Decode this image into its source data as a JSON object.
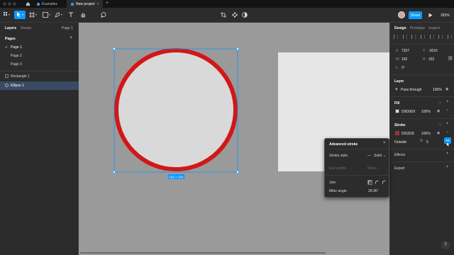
{
  "tabs": [
    {
      "label": "Examples"
    },
    {
      "label": "New project",
      "close": "×"
    }
  ],
  "toolbar": {
    "share_label": "Share",
    "zoom_label": "283%"
  },
  "left_panel": {
    "tabs": [
      "Layers",
      "Assets"
    ],
    "page_indicator": "Page 1",
    "pages_heading": "Pages",
    "pages_add": "+",
    "pages": [
      "Page 1",
      "Page 2",
      "Page 3"
    ],
    "current_check": "✓",
    "layers": [
      {
        "label": "Rectangle 1",
        "icon": "rectangle-icon"
      },
      {
        "label": "Ellipse 1",
        "icon": "ellipse-icon",
        "selected": true
      }
    ]
  },
  "canvas": {
    "selection_size_label": "162 × 162",
    "ellipse_fill": "#D9D9D9",
    "ellipse_stroke": "#D01818"
  },
  "right_panel": {
    "tabs": [
      "Design",
      "Prototype",
      "Inspect"
    ],
    "x_label": "X",
    "x_value": "7337",
    "y_label": "Y",
    "y_value": "-3016",
    "w_label": "W",
    "w_value": "162",
    "h_label": "H",
    "h_value": "162",
    "rotation_label": "L",
    "rotation_value": "0°",
    "layer_heading": "Layer",
    "blend_mode": "Pass through",
    "layer_opacity": "100%",
    "fill_heading": "Fill",
    "fill_hex": "D9D9D9",
    "fill_opacity": "100%",
    "stroke_heading": "Stroke",
    "stroke_hex": "D01818",
    "stroke_opacity": "100%",
    "stroke_position": "Outside",
    "stroke_weight": "5",
    "more_label": "•••",
    "effects_heading": "Effects",
    "export_heading": "Export",
    "help_label": "?",
    "add_label": "+",
    "remove_label": "−"
  },
  "popup": {
    "title": "Advanced stroke",
    "close": "×",
    "stroke_style_label": "Stroke style",
    "stroke_style_value": "Solid",
    "end_points_label": "End points",
    "end_points_value": "None",
    "join_label": "Join",
    "miter_label": "Miter angle",
    "miter_value": "28.96°"
  },
  "colors": {
    "accent": "#0D99FF",
    "panel": "#2C2C2C",
    "canvas": "#9A9A9A",
    "stroke_red": "#D01818"
  }
}
